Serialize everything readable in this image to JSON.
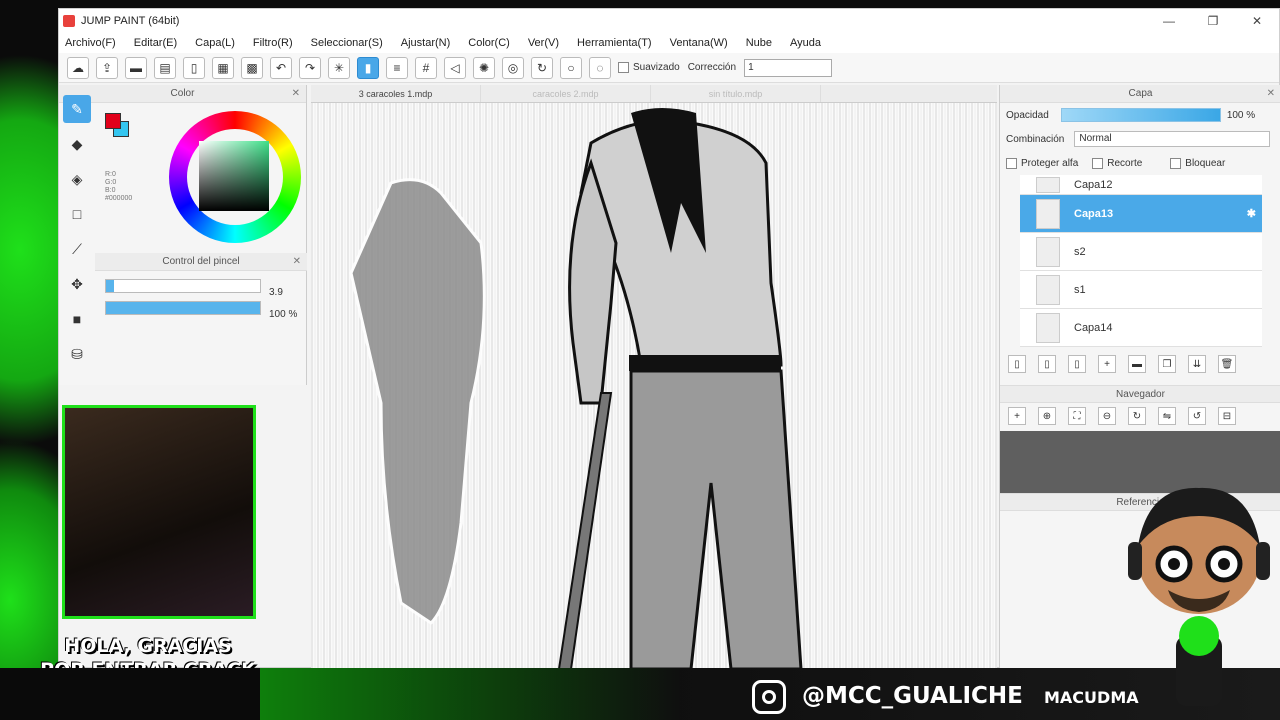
{
  "app": {
    "title": "JUMP PAINT (64bit)",
    "window_controls": [
      "—",
      "❐",
      "✕"
    ]
  },
  "menu": [
    "Archivo(F)",
    "Editar(E)",
    "Capa(L)",
    "Filtro(R)",
    "Seleccionar(S)",
    "Ajustar(N)",
    "Color(C)",
    "Ver(V)",
    "Herramienta(T)",
    "Ventana(W)",
    "Nube",
    "Ayuda"
  ],
  "toolbar": {
    "suavizado_label": "Suavizado",
    "correccion_label": "Corrección",
    "correccion_value": "1"
  },
  "color_panel": {
    "title": "Color",
    "rgb_readout": "R:0\nG:0\nB:0\n#000000"
  },
  "brush_panel": {
    "title": "Control del pincel",
    "size_value": "3.9",
    "size_fraction": 0.05,
    "opacity_value": "100 %",
    "opacity_fraction": 1.0
  },
  "canvas": {
    "tabs": [
      {
        "label": "3 caracoles 1.mdp",
        "dim": false
      },
      {
        "label": "caracoles 2.mdp",
        "dim": true
      },
      {
        "label": "sin título.mdp",
        "dim": true
      }
    ]
  },
  "layer_panel": {
    "title": "Capa",
    "opacity_label": "Opacidad",
    "opacity_value": "100 %",
    "blend_label": "Combinación",
    "blend_value": "Normal",
    "protect_alpha": "Proteger alfa",
    "clip": "Recorte",
    "lock": "Bloquear",
    "layers": [
      {
        "name": "Capa12",
        "selected": false
      },
      {
        "name": "Capa13",
        "selected": true
      },
      {
        "name": "s2",
        "selected": false
      },
      {
        "name": "s1",
        "selected": false
      },
      {
        "name": "Capa14",
        "selected": false
      }
    ]
  },
  "navigator": {
    "title": "Navegador"
  },
  "reference": {
    "title": "Referencia"
  },
  "overlay": {
    "greeting": "HOLA, GRACIAS\nPOR ENTRAR CRACK",
    "instagram_handle": "@MCC_GUALICHE",
    "brand": "MACUDMA"
  },
  "icons": {
    "color_fg": "#e1001a",
    "color_bg": "#34c6f0",
    "accent": "#49a7e8",
    "overlay_green": "#1fe01a"
  }
}
